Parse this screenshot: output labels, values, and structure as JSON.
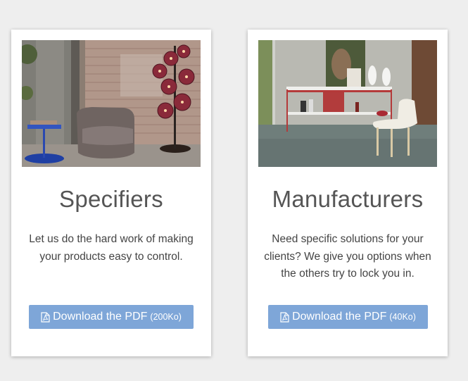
{
  "cards": [
    {
      "title": "Specifiers",
      "description": "Let us do the hard work of making your products easy to control.",
      "button": {
        "label": "Download the PDF",
        "size": "(200Ko)",
        "icon": "pdf-file-icon"
      },
      "image": "lounge-chair-with-glass-globe-floor-lamp"
    },
    {
      "title": "Manufacturers",
      "description": "Need specific solutions for your clients? We give you options when the others try to lock you in.",
      "button": {
        "label": "Download the PDF",
        "size": "(40Ko)",
        "icon": "pdf-file-icon"
      },
      "image": "shelving-unit-with-white-chair"
    }
  ],
  "colors": {
    "button": "#7ea6d8",
    "title": "#555555",
    "text": "#444444",
    "background": "#eeeeee"
  }
}
